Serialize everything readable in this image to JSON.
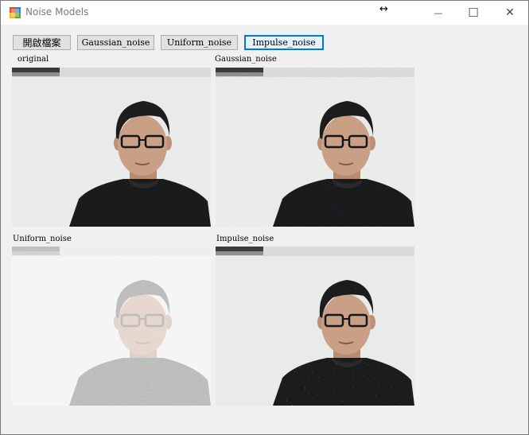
{
  "window": {
    "title": "Noise Models",
    "minimize_symbol": "—",
    "maximize_symbol": "☐",
    "close_symbol": "✕",
    "resize_cursor": "↔"
  },
  "toolbar": {
    "open_file_label": "開啟檔案",
    "gaussian_label": "Gaussian_noise",
    "uniform_label": "Uniform_noise",
    "impulse_label": "Impulse_noise"
  },
  "panels": {
    "original_caption": "original",
    "gaussian_caption": "Gaussian_noise",
    "uniform_caption": "Uniform_noise",
    "impulse_caption": "Impulse_noise"
  },
  "colors": {
    "focus_border": "#0078d7",
    "shirt": "#1b1b1d",
    "skin": "#c9a085",
    "hair": "#1e1c1c",
    "wall": "#eceeee"
  },
  "icons": {
    "app": "app-window-icon",
    "minimize": "minimize-icon",
    "maximize": "maximize-icon",
    "close": "close-icon"
  }
}
